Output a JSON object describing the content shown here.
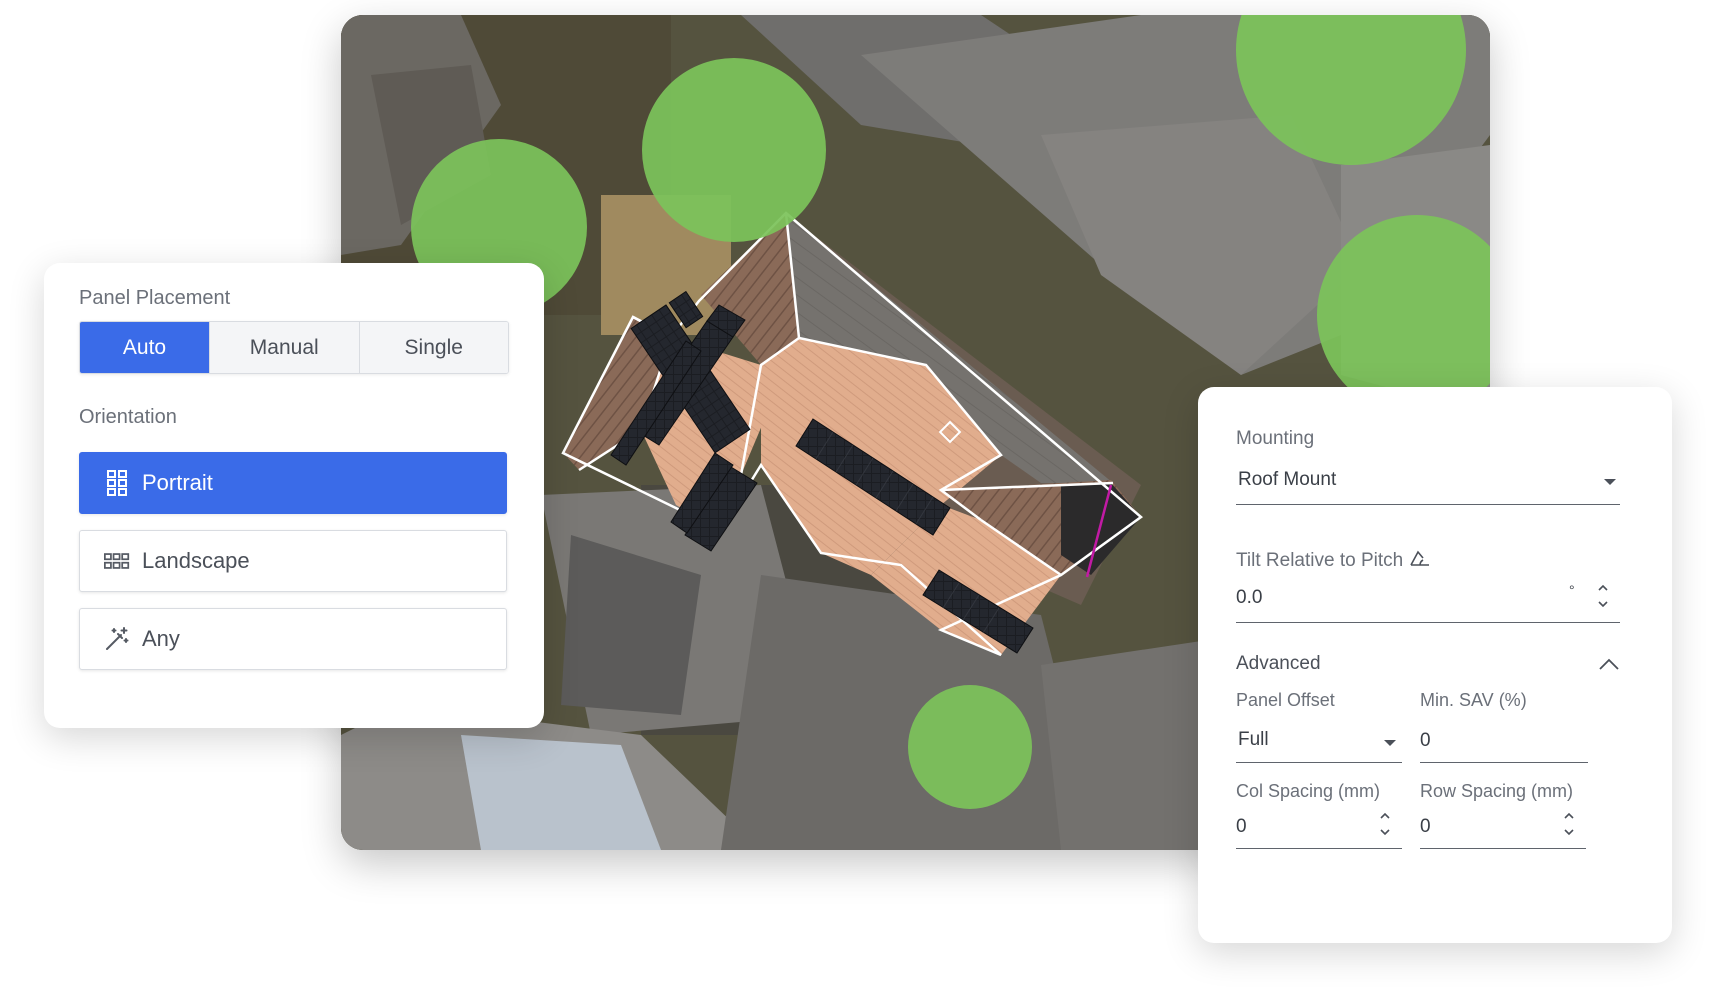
{
  "panel_placement": {
    "label": "Panel Placement",
    "options": [
      "Auto",
      "Manual",
      "Single"
    ],
    "selected": "Auto"
  },
  "orientation": {
    "label": "Orientation",
    "options": [
      {
        "label": "Portrait",
        "icon": "grid-portrait-icon"
      },
      {
        "label": "Landscape",
        "icon": "grid-landscape-icon"
      },
      {
        "label": "Any",
        "icon": "magic-wand-icon"
      }
    ],
    "selected": "Portrait"
  },
  "mounting": {
    "label": "Mounting",
    "value": "Roof Mount"
  },
  "tilt": {
    "label": "Tilt Relative to Pitch",
    "value": "0.0",
    "unit": "°"
  },
  "advanced": {
    "label": "Advanced",
    "panel_offset": {
      "label": "Panel Offset",
      "value": "Full"
    },
    "min_sav": {
      "label": "Min. SAV (%)",
      "value": "0"
    },
    "col_spacing": {
      "label": "Col Spacing (mm)",
      "value": "0"
    },
    "row_spacing": {
      "label": "Row Spacing (mm)",
      "value": "0"
    }
  },
  "colors": {
    "accent": "#3a6be8",
    "tree_overlay": "#7cc35a",
    "roof_highlight": "#e3b192"
  }
}
